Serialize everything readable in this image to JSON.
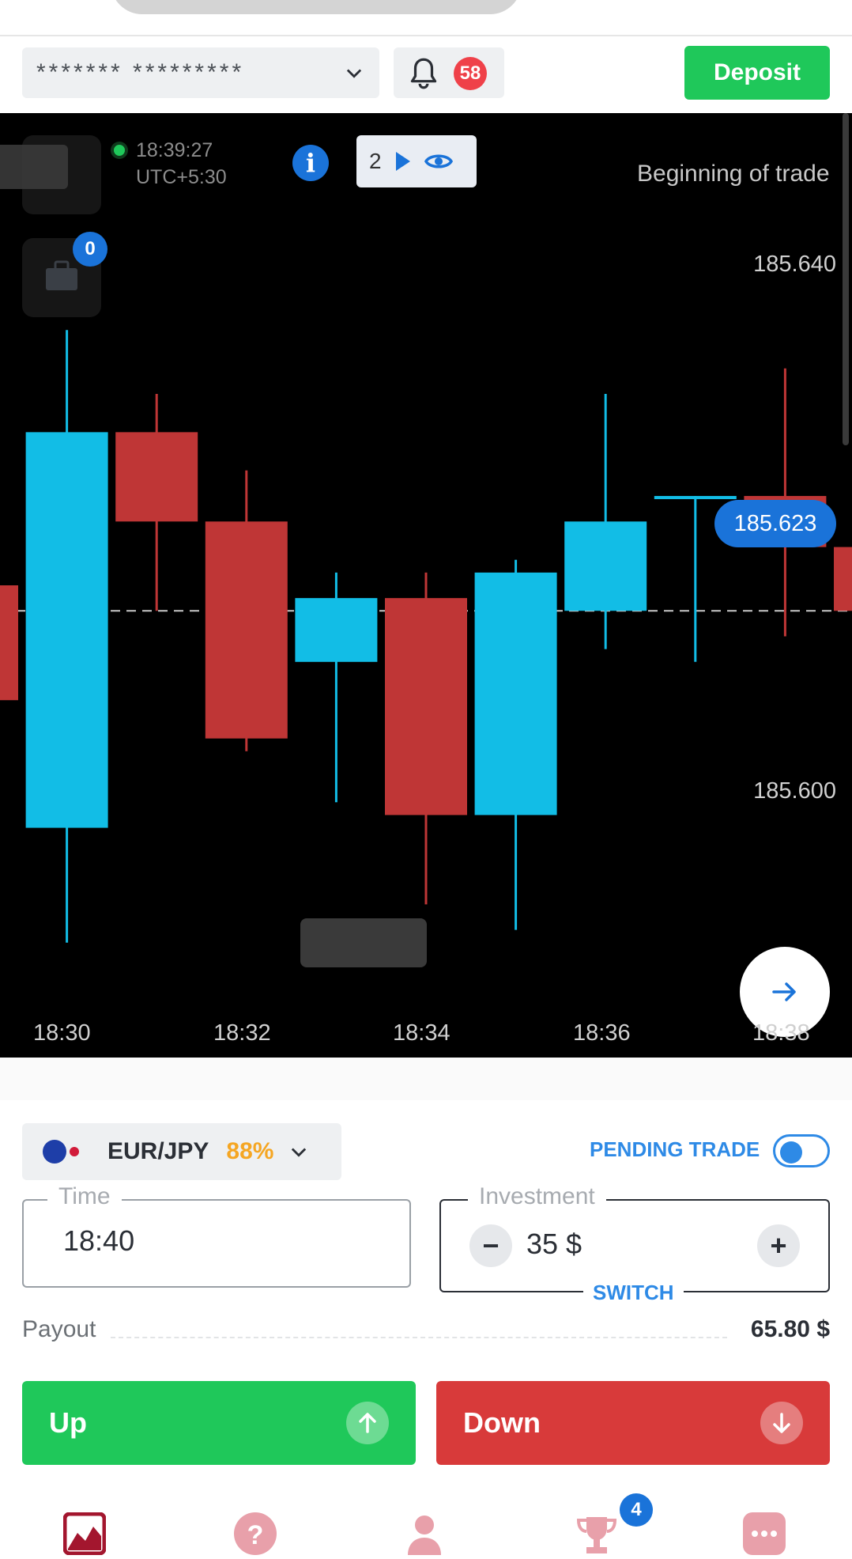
{
  "header": {
    "account_mask": "******* *********",
    "notifications_count": "58",
    "deposit_label": "Deposit"
  },
  "chart": {
    "clock_time": "18:39:27",
    "timezone": "UTC+5:30",
    "info_label": "i",
    "signals_count": "2",
    "trades_badge": "0",
    "beginning_label": "Beginning of trade",
    "current_price": "185.623",
    "y_ticks": [
      "185.640",
      "185.600"
    ],
    "x_ticks": [
      "18:30",
      "18:32",
      "18:34",
      "18:36",
      "18:38"
    ]
  },
  "chart_data": {
    "type": "candlestick",
    "x": [
      "18:29",
      "18:30",
      "18:31",
      "18:32",
      "18:33",
      "18:34",
      "18:35",
      "18:36",
      "18:37",
      "18:38",
      "18:39"
    ],
    "series": [
      {
        "open": [
          185.625,
          185.606,
          185.637,
          185.63,
          185.619,
          185.624,
          185.607,
          185.623,
          185.632,
          185.632,
          185.628
        ],
        "close": [
          185.616,
          185.637,
          185.63,
          185.613,
          185.624,
          185.607,
          185.626,
          185.63,
          185.632,
          185.628,
          185.623
        ],
        "high": [
          185.627,
          185.645,
          185.64,
          185.634,
          185.626,
          185.626,
          185.627,
          185.64,
          185.632,
          185.642,
          185.628
        ],
        "low": [
          185.612,
          185.597,
          185.623,
          185.612,
          185.608,
          185.6,
          185.598,
          185.62,
          185.619,
          185.621,
          185.62
        ]
      }
    ],
    "colors": {
      "up": "#12bde6",
      "down": "#bf3636"
    },
    "current_price": 185.623,
    "ylim": [
      185.588,
      185.662
    ],
    "y_ticks": [
      185.64,
      185.6
    ],
    "x_ticks": [
      "18:30",
      "18:32",
      "18:34",
      "18:36",
      "18:38"
    ]
  },
  "trade": {
    "asset": "EUR/JPY",
    "payout_pct": "88%",
    "pending_label": "PENDING TRADE",
    "time_legend": "Time",
    "time_value": "18:40",
    "investment_legend": "Investment",
    "investment_value": "35 $",
    "switch_label": "SWITCH",
    "payout_label": "Payout",
    "payout_value": "65.80 $",
    "up_label": "Up",
    "down_label": "Down"
  },
  "nav": {
    "trophy_badge": "4",
    "icons": [
      "chart-icon",
      "help-icon",
      "profile-icon",
      "trophy-icon",
      "more-icon"
    ]
  },
  "colors": {
    "green": "#1fc85a",
    "red": "#d83a3a",
    "blue": "#1a73d9",
    "orange": "#f5a623"
  }
}
